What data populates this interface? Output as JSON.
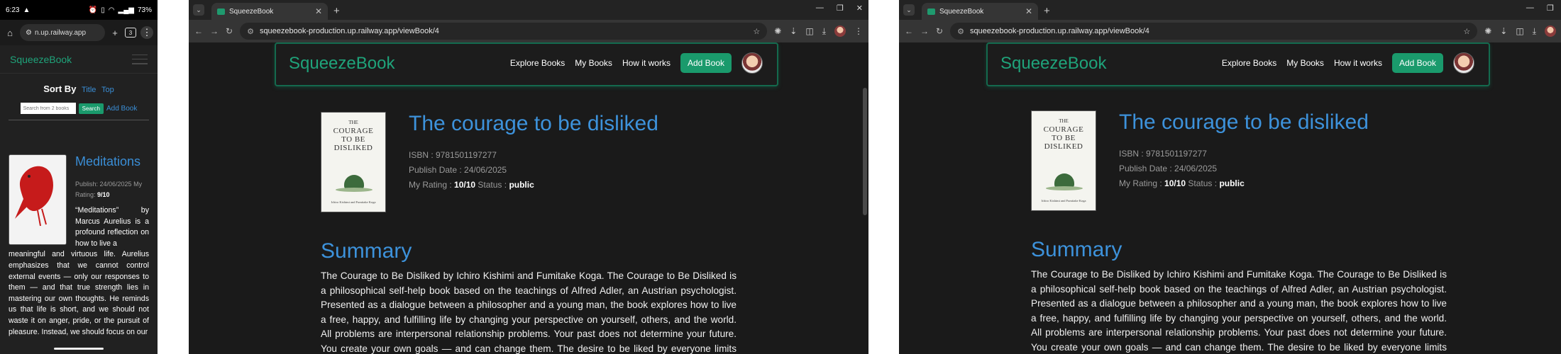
{
  "phone": {
    "status": {
      "time": "6:23",
      "battery": "73%"
    },
    "url": "n.up.railway.app",
    "tabs_count": "3",
    "brand": "SqueezeBook",
    "sort_label": "Sort By",
    "sort_title": "Title",
    "sort_top": "Top",
    "search_placeholder": "Search from 2 books",
    "search_button": "Search",
    "add_book": "Add Book",
    "book": {
      "title": "Meditations",
      "publish": "Publish: 24/06/2025",
      "rating_label": "My Rating:",
      "rating": "9/10",
      "desc_lead": "“Meditations” by Marcus Aurelius is a profound reflection on how to live a",
      "desc_rest": "meaningful and virtuous life. Aurelius emphasizes that we cannot control external events — only our responses to them — and that true strength lies in mastering our own thoughts. He reminds us that life is short, and we should not waste it on anger, pride, or the pursuit of pleasure. Instead, we should focus on our"
    }
  },
  "browser": {
    "tab_title": "SqueezeBook",
    "url": "squeezebook-production.up.railway.app/viewBook/4"
  },
  "site": {
    "brand": "SqueezeBook",
    "nav": {
      "explore": "Explore Books",
      "my_books": "My Books",
      "how": "How it works",
      "add": "Add Book"
    }
  },
  "book": {
    "title": "The courage to be disliked",
    "isbn": "ISBN : 9781501197277",
    "publish": "Publish Date : 24/06/2025",
    "rating_label": "My Rating :",
    "rating": "10/10",
    "status_label": "Status :",
    "status": "public",
    "cover": {
      "the": "THE",
      "line1": "COURAGE",
      "line2": "TO BE",
      "line3": "DISLIKED",
      "authors": "Ichiro Kishimi and Fumitake Koga"
    },
    "summary_heading": "Summary",
    "summary_text": "The Courage to Be Disliked by Ichiro Kishimi and Fumitake Koga. The Courage to Be Disliked is a philosophical self-help book based on the teachings of Alfred Adler, an Austrian psychologist. Presented as a dialogue between a philosopher and a young man, the book explores how to live a free, happy, and fulfilling life by changing your perspective on yourself, others, and the world. All problems are interpersonal relationship problems. Your past does not determine your future. You create your own goals — and can change them. The desire to be liked by everyone limits freedom."
  }
}
